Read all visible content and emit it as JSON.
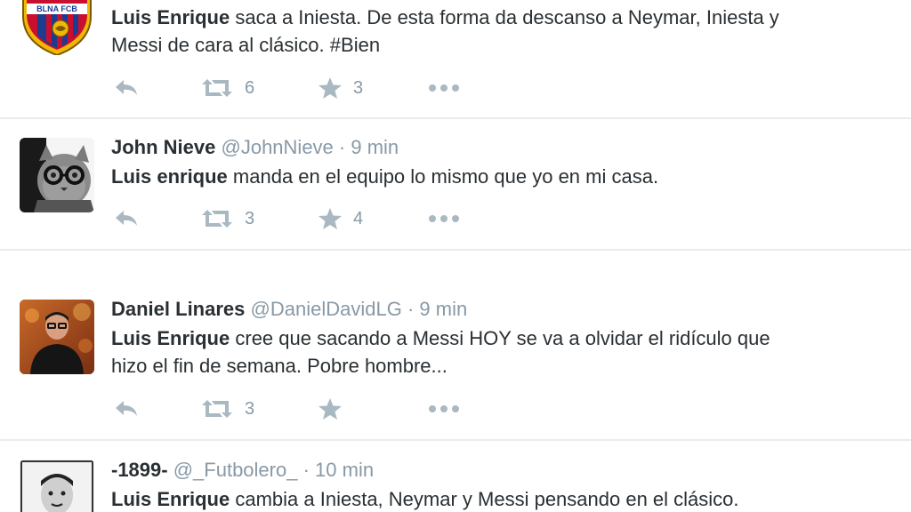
{
  "tweets": [
    {
      "fullname": "",
      "username": "",
      "time": "",
      "keyword": "Luis Enrique",
      "text_line1": " saca a Iniesta. De esta forma da descanso a Neymar, Iniesta y",
      "text_line2": "Messi de cara al clásico. ",
      "hashtag_symbol": "#",
      "hashtag": "Bien",
      "retweets": "6",
      "favorites": "3",
      "avatar": "fcb-crest-icon"
    },
    {
      "fullname": "John Nieve",
      "username": "@JohnNieve",
      "dot": "·",
      "time": "9 min",
      "keyword": "Luis enrique",
      "text_line1": " manda en el equipo lo mismo que yo en mi casa.",
      "retweets": "3",
      "favorites": "4",
      "avatar": "cat-with-glasses"
    },
    {
      "fullname": "Daniel Linares",
      "username": "@DanielDavidLG",
      "dot": "·",
      "time": "9 min",
      "keyword": "Luis Enrique",
      "text_line1": " cree que sacando a Messi HOY se va a olvidar el ridículo que",
      "text_line2": "hizo el fin de semana. Pobre hombre...",
      "retweets": "3",
      "favorites": "",
      "avatar": "man-portrait"
    },
    {
      "fullname": "-1899-",
      "username": "@_Futbolero_",
      "dot": "·",
      "time": "10 min",
      "keyword": "Luis Enrique",
      "text_line1": " cambia a Iniesta, Neymar y Messi pensando en el clásico.",
      "avatar": "vintage-portrait"
    }
  ],
  "colors": {
    "text": "#292f33",
    "meta": "#8899a6",
    "icon": "#aab8c2",
    "divider": "#e6ecf0",
    "crest_red": "#c8102e",
    "crest_blue": "#1d3c8f",
    "crest_gold": "#f2b705"
  }
}
